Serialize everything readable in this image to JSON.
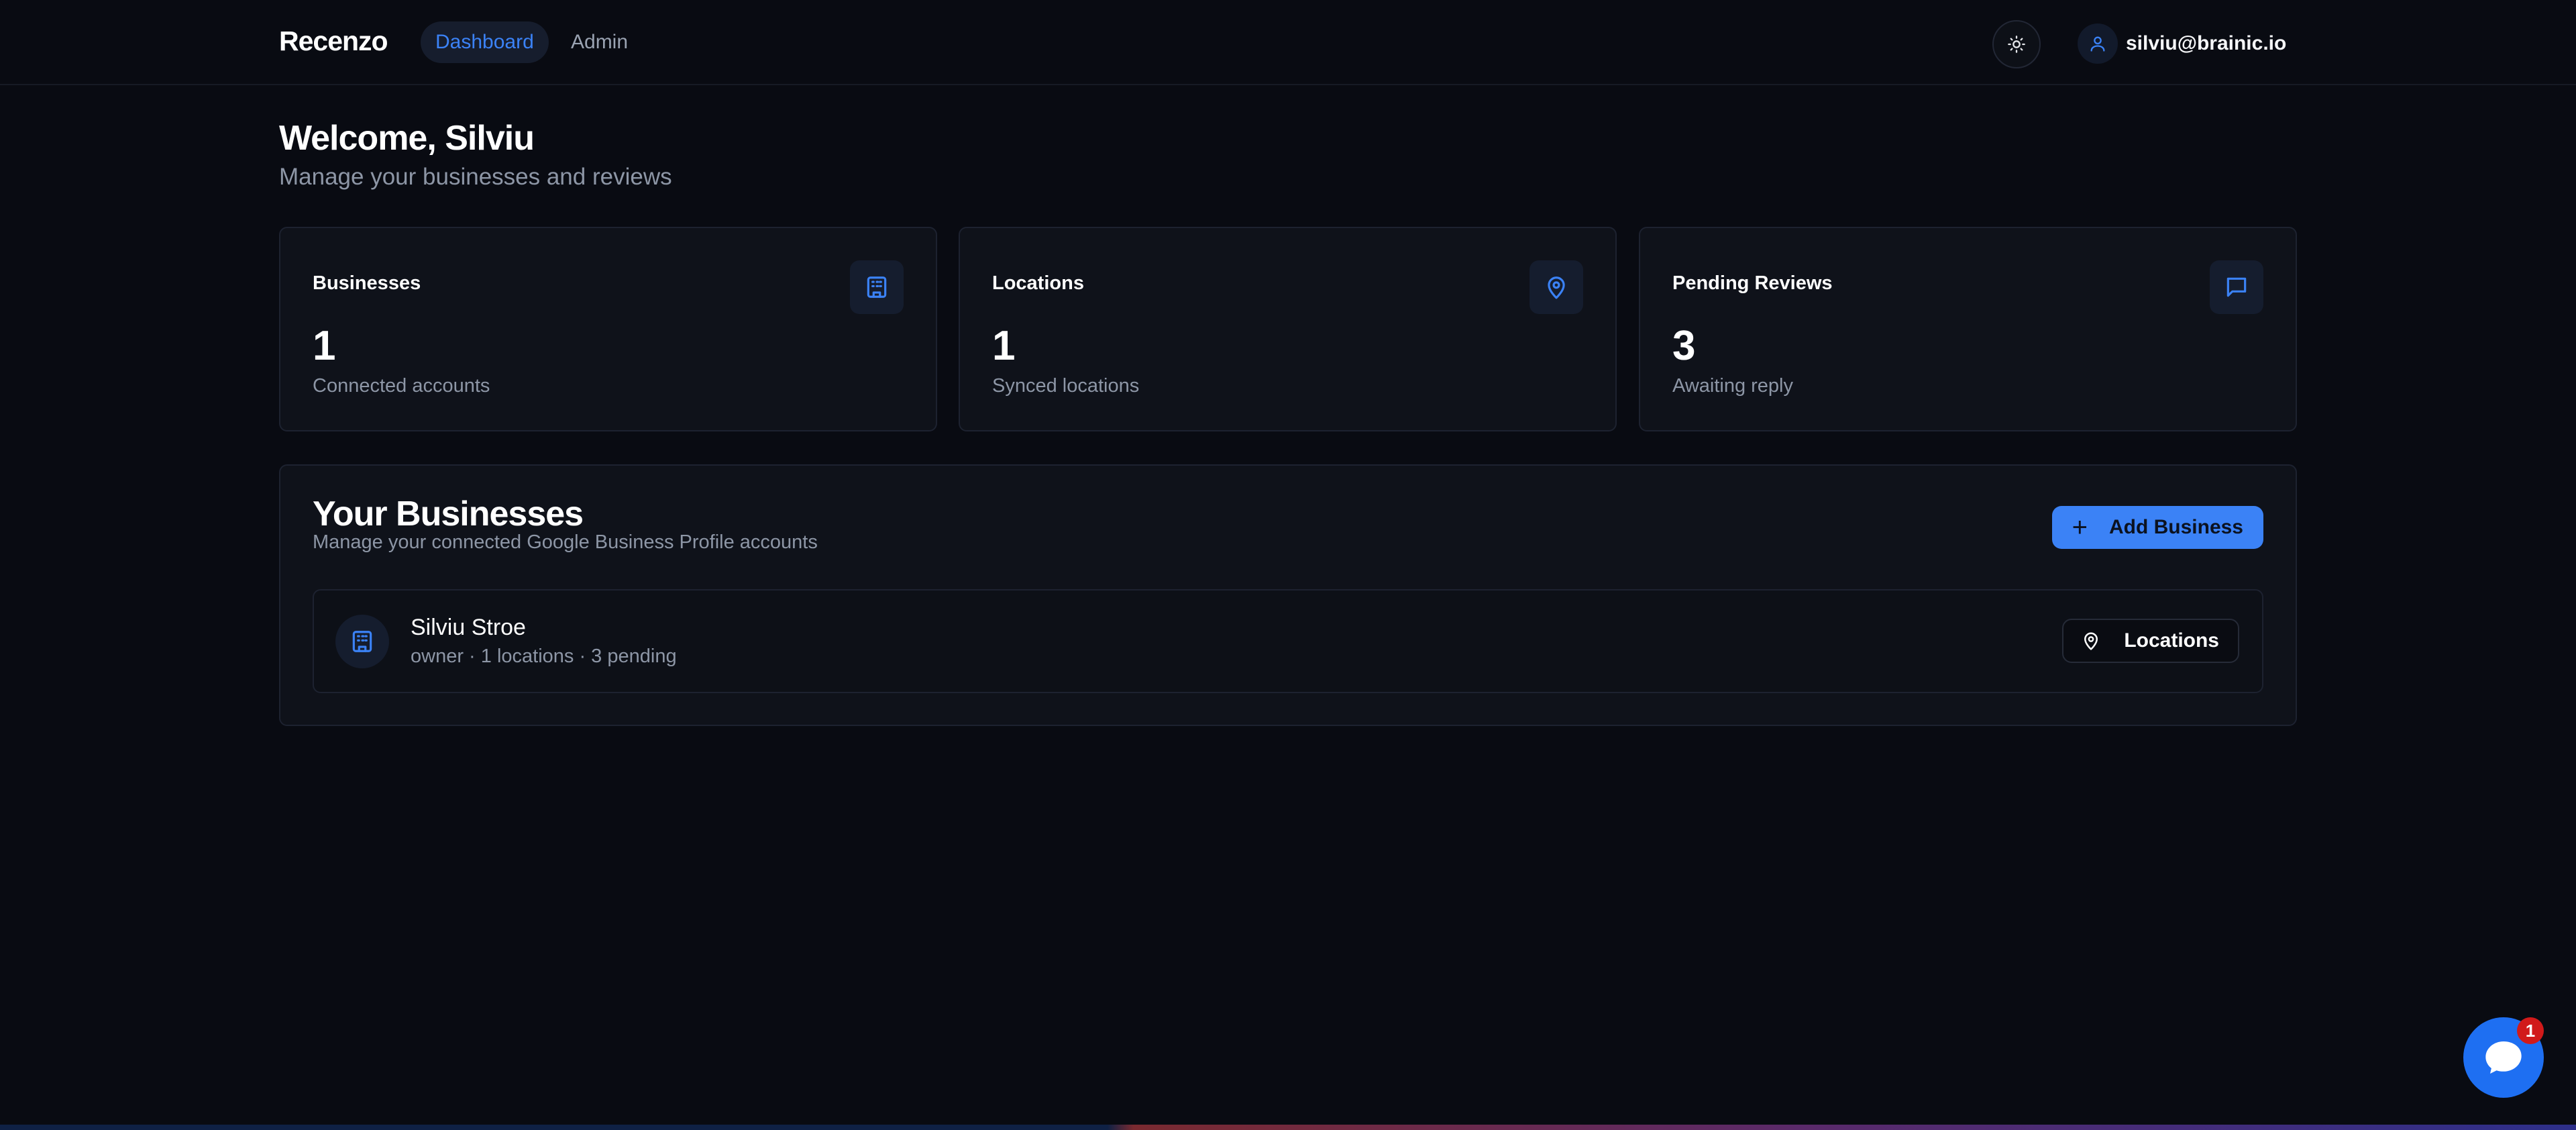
{
  "header": {
    "brand": "Recenzo",
    "nav": [
      {
        "label": "Dashboard",
        "active": true
      },
      {
        "label": "Admin",
        "active": false
      }
    ],
    "theme_toggle_icon": "sun-icon",
    "user_email": "silviu@brainic.io"
  },
  "welcome": {
    "title": "Welcome, Silviu",
    "subtitle": "Manage your businesses and reviews"
  },
  "stats": [
    {
      "label": "Businesses",
      "value": "1",
      "caption": "Connected accounts",
      "icon": "building-icon"
    },
    {
      "label": "Locations",
      "value": "1",
      "caption": "Synced locations",
      "icon": "map-pin-icon"
    },
    {
      "label": "Pending Reviews",
      "value": "3",
      "caption": "Awaiting reply",
      "icon": "message-square-icon"
    }
  ],
  "businesses": {
    "title": "Your Businesses",
    "subtitle": "Manage your connected Google Business Profile accounts",
    "add_button": "Add Business",
    "items": [
      {
        "name": "Silviu Stroe",
        "meta": "owner · 1 locations · 3 pending",
        "action": "Locations"
      }
    ]
  },
  "chat": {
    "badge": "1"
  },
  "colors": {
    "accent": "#3b82f6",
    "background": "#090b12",
    "card": "#0f121a",
    "badge": "#d11a1a"
  }
}
